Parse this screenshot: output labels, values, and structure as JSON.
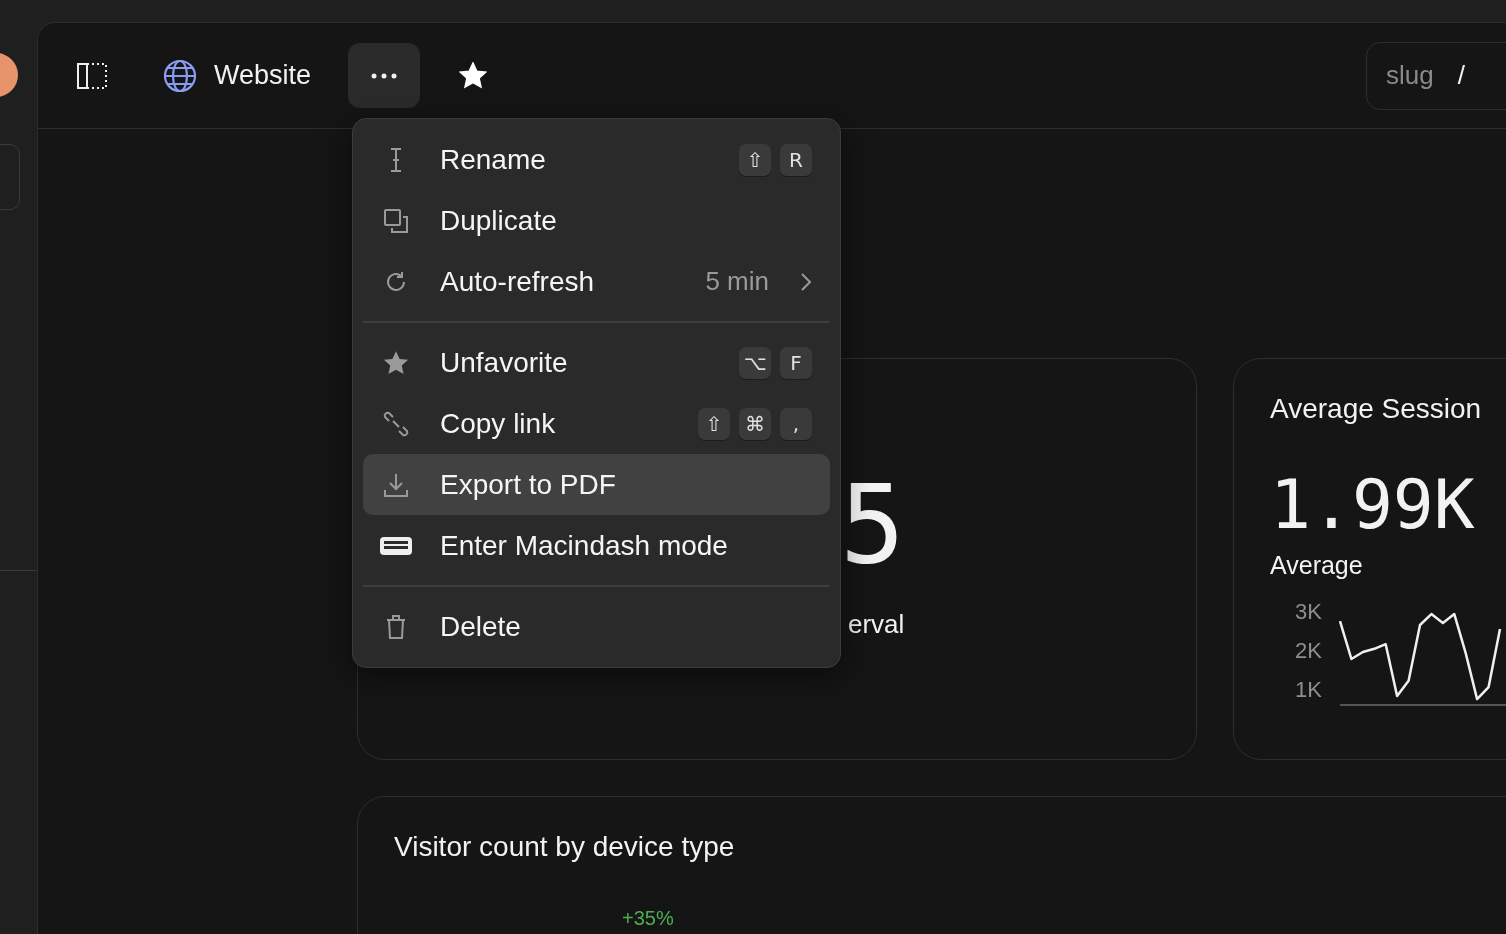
{
  "header": {
    "title": "Website",
    "more_button": {
      "pressed": true
    },
    "favorited": true,
    "slug_field": {
      "label": "slug",
      "separator": "/"
    }
  },
  "menu": {
    "sections": [
      {
        "items": [
          {
            "label": "Rename",
            "shortcut": [
              "⇧",
              "R"
            ],
            "submenu": false,
            "selected": false
          },
          {
            "label": "Duplicate",
            "submenu": false,
            "selected": false
          },
          {
            "label": "Auto-refresh",
            "value": "5 min",
            "submenu": true,
            "selected": false
          }
        ]
      },
      {
        "items": [
          {
            "label": "Unfavorite",
            "shortcut": [
              "⌥",
              "F"
            ],
            "submenu": false,
            "selected": false
          },
          {
            "label": "Copy link",
            "shortcut": [
              "⇧",
              "⌘",
              ","
            ],
            "submenu": false,
            "selected": false
          },
          {
            "label": "Export to PDF",
            "submenu": false,
            "selected": true
          },
          {
            "label": "Enter Macindash mode",
            "submenu": false,
            "selected": false
          }
        ]
      },
      {
        "items": [
          {
            "label": "Delete",
            "submenu": false,
            "selected": false
          }
        ]
      }
    ]
  },
  "cards": [
    {
      "kind": "stat",
      "value": "5",
      "caption": "erval"
    },
    {
      "kind": "chart",
      "title": "Average Session",
      "value": "1.99K",
      "chart_data": {
        "type": "line",
        "ylim": [
          590,
          3000
        ],
        "categories": [
          null,
          null,
          null,
          null,
          null,
          null,
          null,
          null,
          null,
          null,
          null,
          null,
          null,
          null,
          null
        ],
        "yticks": [
          {
            "value": 1000,
            "label": "1K"
          },
          {
            "value": 2000,
            "label": "2K"
          },
          {
            "value": 3000,
            "label": "3K"
          }
        ],
        "series": [
          {
            "name": "Average",
            "color": "#f0f0f0",
            "values": [
              2740,
              1770,
              1950,
              2030,
              2150,
              820,
              1210,
              2640,
              2920,
              2690,
              2920,
              1920,
              740,
              1050,
              2540
            ]
          }
        ]
      }
    },
    {
      "kind": "device",
      "title": "Visitor count by device type",
      "change": "+35%"
    }
  ]
}
